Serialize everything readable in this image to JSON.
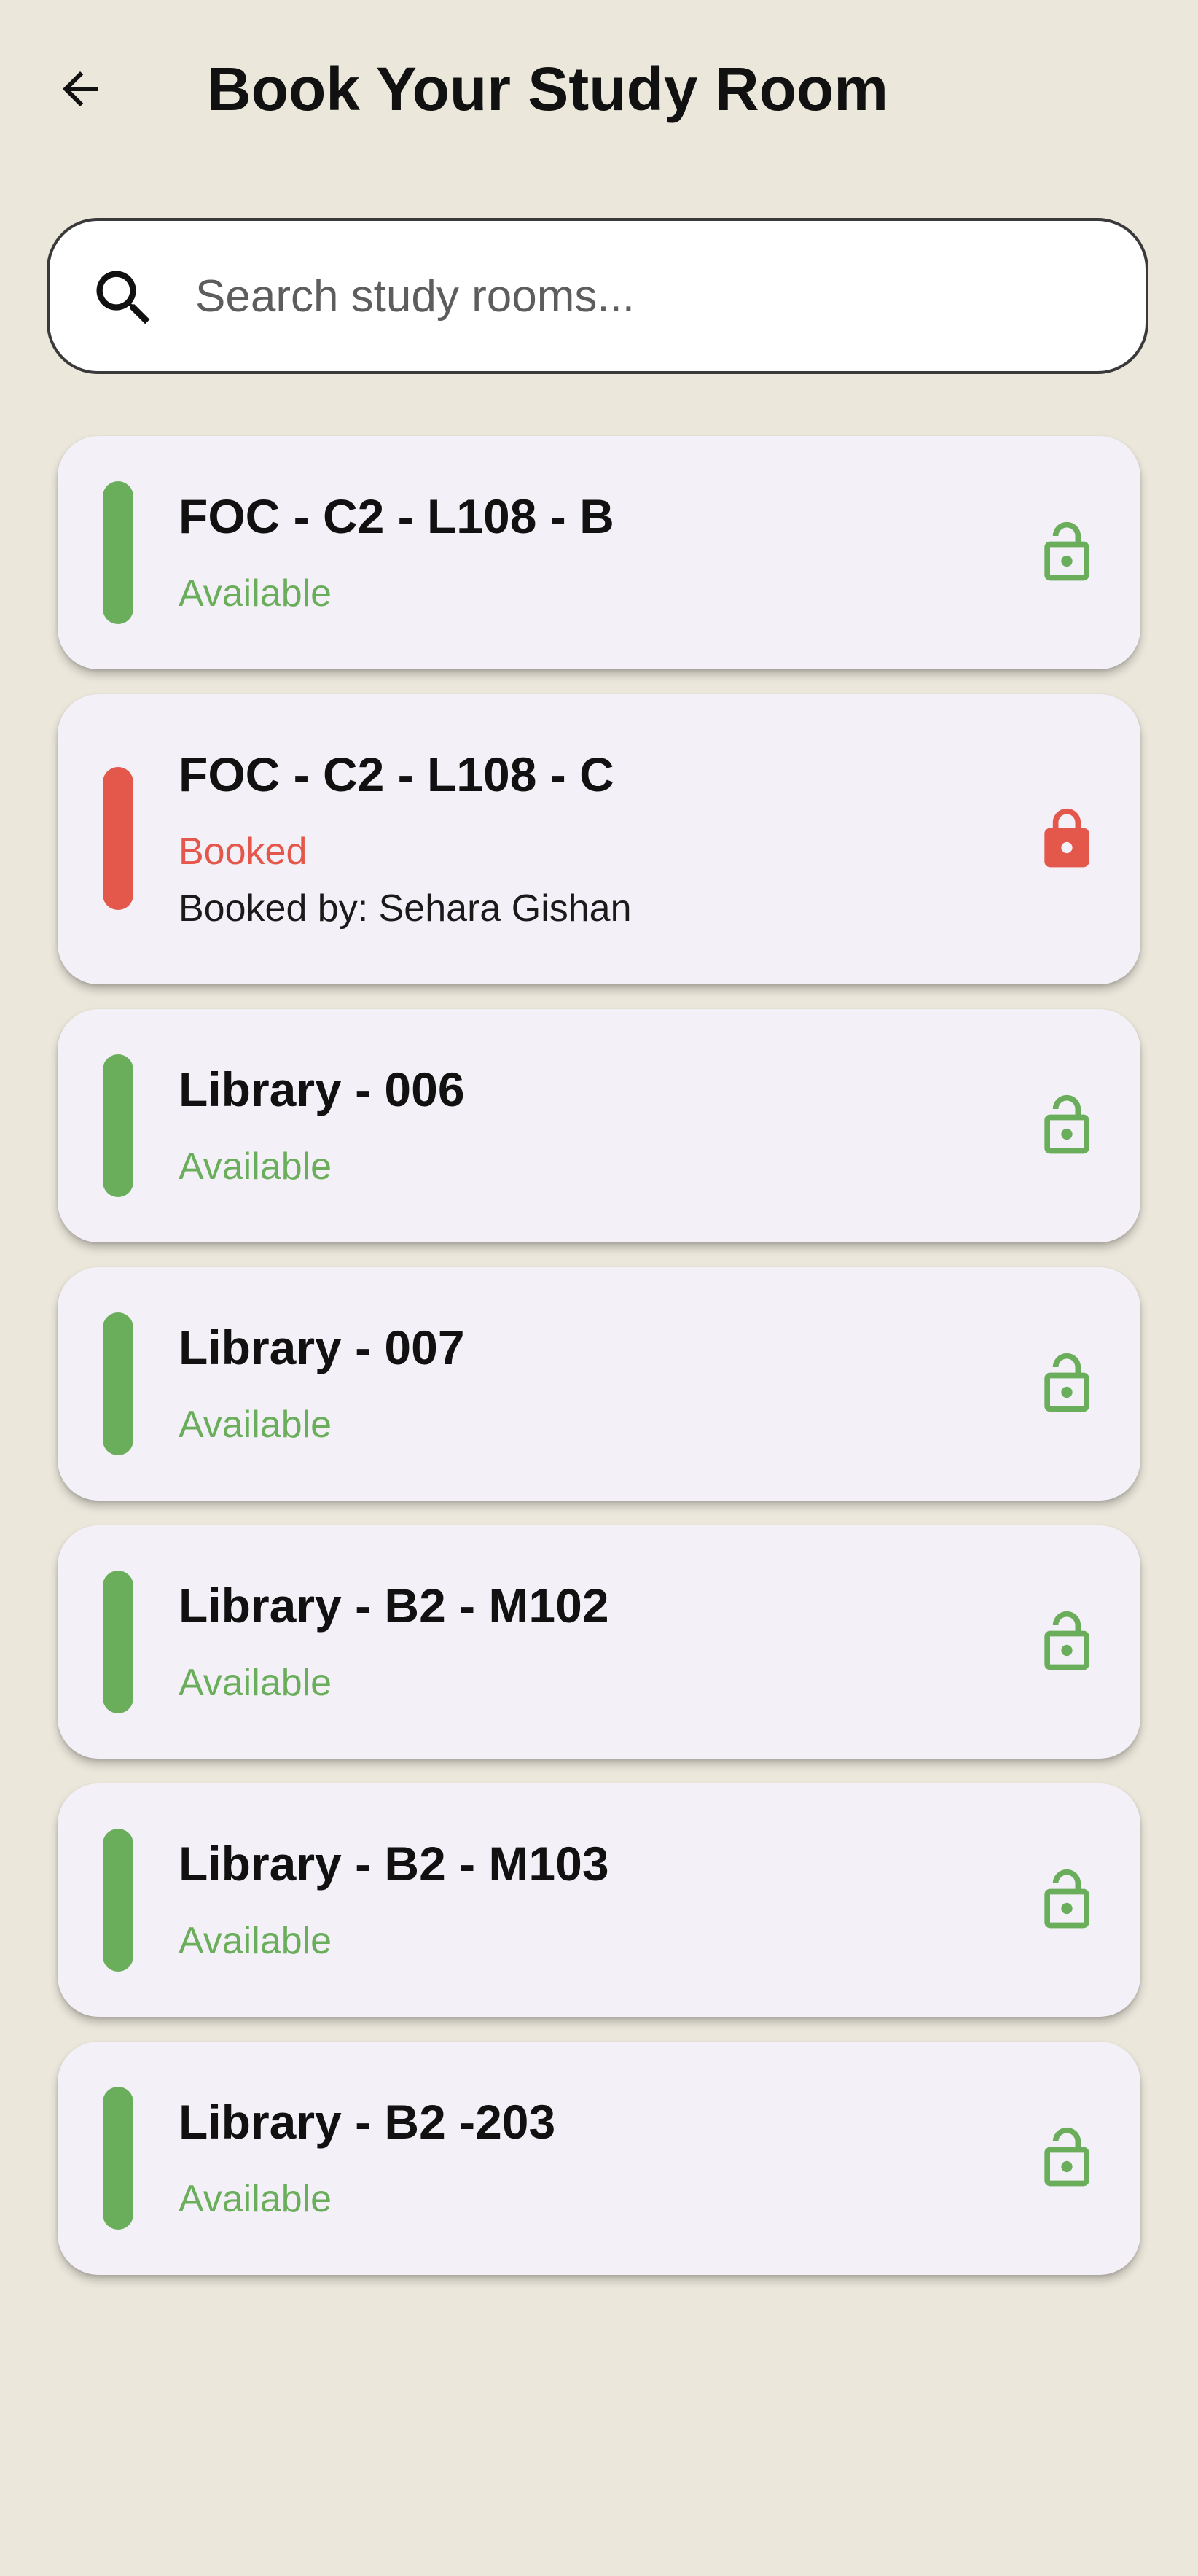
{
  "header": {
    "back_icon": "arrow-left-icon",
    "title": "Book Your Study Room"
  },
  "search": {
    "icon": "search-icon",
    "placeholder": "Search study rooms...",
    "value": ""
  },
  "colors": {
    "available": "#6AAE5C",
    "booked": "#E4574B",
    "card_background": "#F3F0F7",
    "page_background": "#EBE7DB"
  },
  "rooms": [
    {
      "name": "FOC - C2 - L108 - B",
      "status": "Available",
      "lock_icon": "lock-open-icon"
    },
    {
      "name": "FOC - C2 - L108 - C",
      "status": "Booked",
      "booked_by": "Booked by: Sehara Gishan",
      "lock_icon": "lock-closed-icon"
    },
    {
      "name": "Library - 006",
      "status": "Available",
      "lock_icon": "lock-open-icon"
    },
    {
      "name": "Library - 007",
      "status": "Available",
      "lock_icon": "lock-open-icon"
    },
    {
      "name": "Library - B2 - M102",
      "status": "Available",
      "lock_icon": "lock-open-icon"
    },
    {
      "name": "Library - B2 - M103",
      "status": "Available",
      "lock_icon": "lock-open-icon"
    },
    {
      "name": "Library - B2 -203",
      "status": "Available",
      "lock_icon": "lock-open-icon"
    }
  ]
}
